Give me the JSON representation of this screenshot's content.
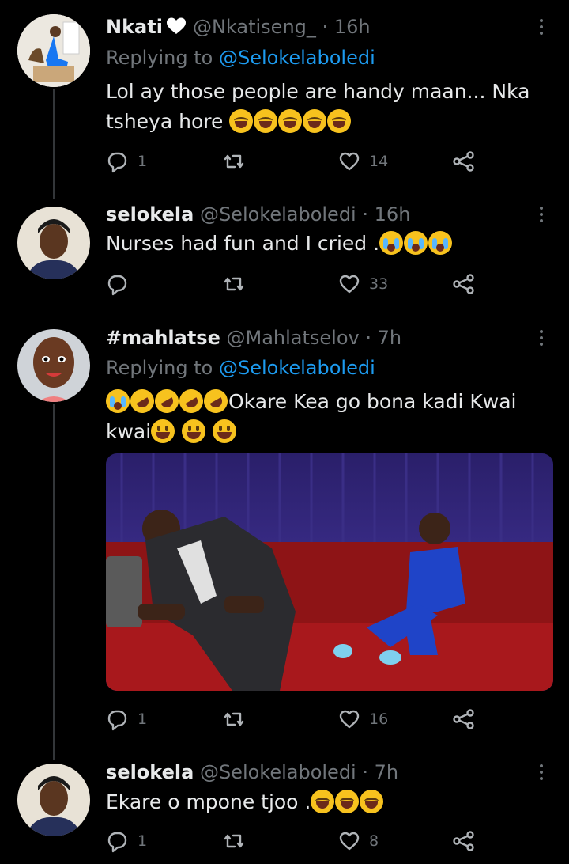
{
  "tweets": [
    {
      "name": "Nkati",
      "handle": "@Nkatiseng_",
      "time": "16h",
      "replying_label": "Replying to",
      "replying_to": "@Selokelaboledi",
      "text_line1": "Lol ay those people are handy maan... Nka",
      "text_line2": "tsheya hore",
      "emojis": [
        "joy",
        "joy",
        "joy",
        "joy",
        "joy"
      ],
      "replies": "1",
      "retweets": "",
      "likes": "14"
    },
    {
      "name": "selokela",
      "handle": "@Selokelaboledi",
      "time": "16h",
      "text_line1": "Nurses had fun and I cried .",
      "emojis": [
        "cry",
        "cry",
        "cry"
      ],
      "replies": "",
      "retweets": "",
      "likes": "33"
    },
    {
      "name": "#mahlatse",
      "handle": "@Mahlatselov",
      "time": "7h",
      "replying_label": "Replying to",
      "replying_to": "@Selokelaboledi",
      "emojis_lead": [
        "cry",
        "rofl",
        "rofl",
        "rofl",
        "rofl"
      ],
      "text_line1": "Okare Kea go bona kadi Kwai",
      "text_line2": "kwai",
      "emojis_tail": [
        "grin",
        "grin",
        "grin"
      ],
      "media": "photo",
      "replies": "1",
      "retweets": "",
      "likes": "16"
    },
    {
      "name": "selokela",
      "handle": "@Selokelaboledi",
      "time": "7h",
      "text_line1": "Ekare o mpone tjoo .",
      "emojis": [
        "joy",
        "joy",
        "joy"
      ],
      "replies": "1",
      "retweets": "",
      "likes": "8"
    }
  ],
  "separator": "·",
  "icons": {
    "reply": "reply-icon",
    "retweet": "retweet-icon",
    "like": "heart-icon",
    "share": "share-icon",
    "more": "more-icon",
    "verified": "heart-emoji"
  },
  "colors": {
    "background": "#000000",
    "text": "#e7e9ea",
    "muted": "#71767b",
    "link": "#1d9bf0"
  }
}
